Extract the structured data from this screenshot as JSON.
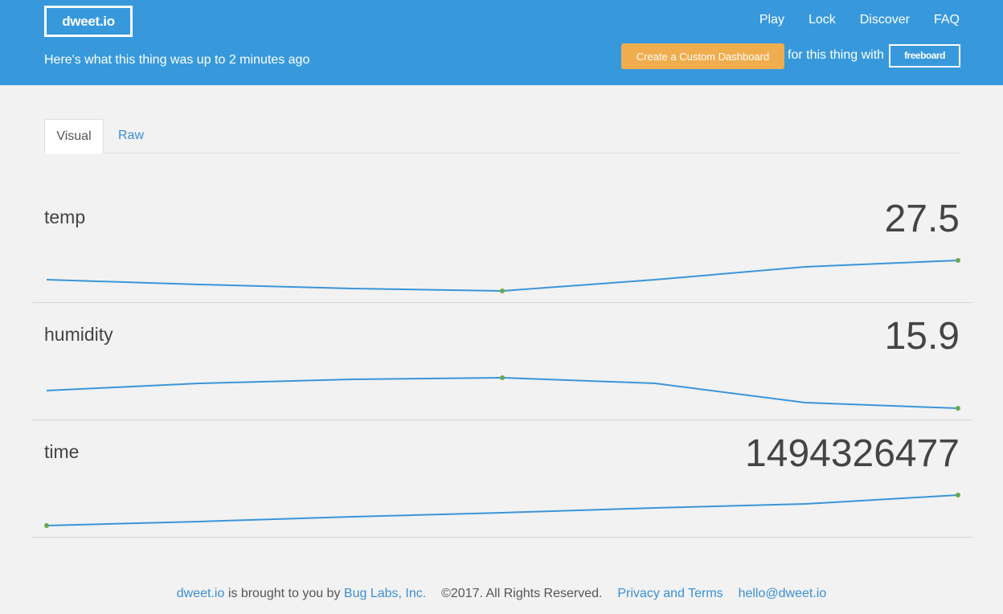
{
  "header": {
    "logo": "dweet.io",
    "tagline": "Here's what this thing was up to 2 minutes ago",
    "nav": [
      "Play",
      "Lock",
      "Discover",
      "FAQ"
    ],
    "dashboard_button": "Create a Custom Dashboard",
    "with_text": "for this thing with",
    "freeboard": "freeboard"
  },
  "tabs": {
    "visual": "Visual",
    "raw": "Raw"
  },
  "metrics": [
    {
      "name": "temp",
      "value": "27.5"
    },
    {
      "name": "humidity",
      "value": "15.9"
    },
    {
      "name": "time",
      "value": "1494326477"
    }
  ],
  "footer": {
    "brand": "dweet.io",
    "brought": "is brought to you by",
    "company": "Bug Labs, Inc.",
    "copyright": "©2017. All Rights Reserved.",
    "privacy": "Privacy and Terms",
    "email": "hello@dweet.io"
  },
  "colors": {
    "header": "#3799dc",
    "accent_button": "#f0ad4e",
    "spark_line": "#3a95d9",
    "spark_dot": "#6aa84f",
    "link": "#3a8fd4"
  }
}
